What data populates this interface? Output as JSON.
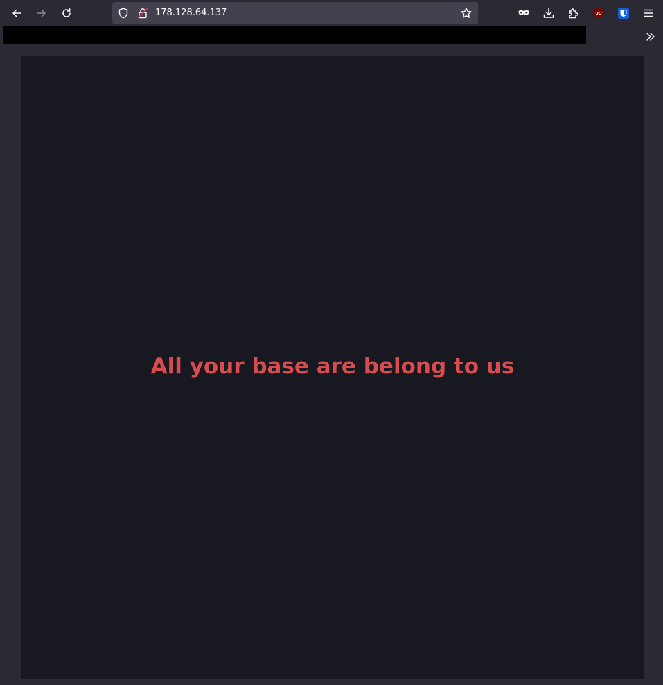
{
  "browser": {
    "url": "178.128.64.137",
    "icons": {
      "back": "arrow-left-icon",
      "forward": "arrow-right-icon",
      "reload": "reload-icon",
      "tracking_protection": "shield-icon",
      "insecure_lock": "lock-insecure-icon",
      "bookmark_star": "star-icon",
      "private_mask": "mask-icon",
      "downloads": "download-icon",
      "extensions": "puzzle-icon",
      "ublock": "ublock-icon",
      "bitwarden": "bitwarden-icon",
      "menu": "hamburger-menu-icon",
      "bookmarks_overflow": "chevron-double-right-icon"
    },
    "colors": {
      "chrome_bg": "#2b2a33",
      "urlbar_bg": "#42414d",
      "page_bg": "#181820",
      "headline": "#d84c4f",
      "ublock_red": "#800000",
      "bitwarden_blue": "#175ddc"
    }
  },
  "page": {
    "headline": "All your base are belong to us"
  }
}
